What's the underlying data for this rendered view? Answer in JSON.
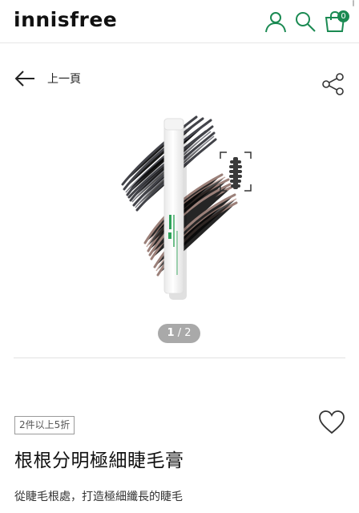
{
  "header": {
    "logo": "innisfree",
    "cart_count": "0",
    "accent_color": "#1a8a52"
  },
  "nav": {
    "back_label": "上一頁"
  },
  "gallery": {
    "current": "1",
    "separator": "/",
    "total": "2"
  },
  "product": {
    "promo_tag": "2件以上5折",
    "name": "根根分明極細睫毛膏",
    "description": "從睫毛根處，打造極細纖長的睫毛"
  }
}
